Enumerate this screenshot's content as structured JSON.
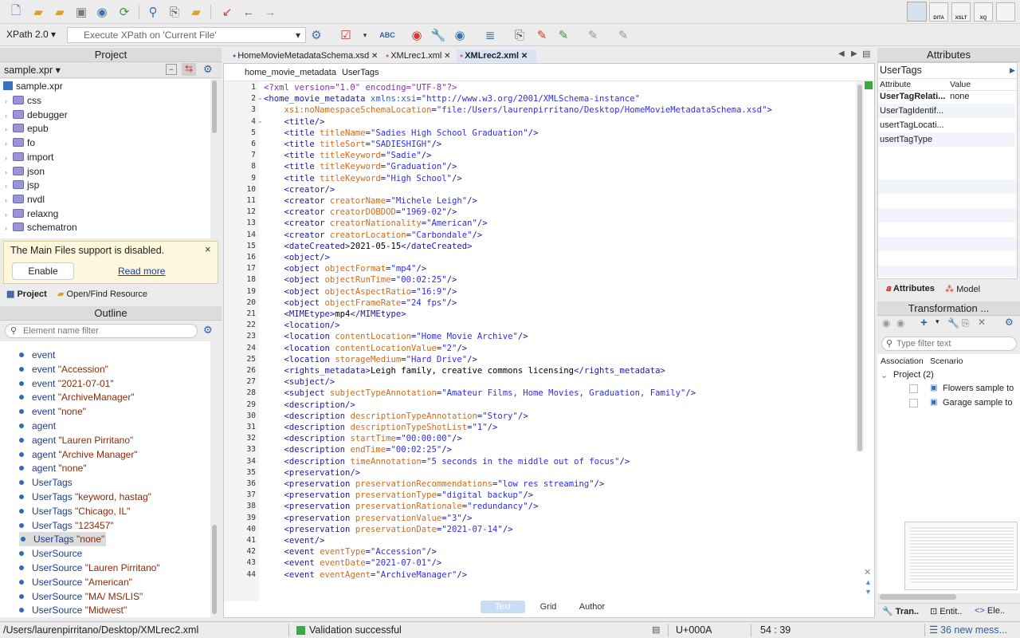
{
  "toolbar": {
    "xpath_version": "XPath 2.0",
    "xpath_placeholder": "Execute XPath on  'Current File'"
  },
  "right_toolbar": [
    "DITA",
    "XSLT",
    "XQ"
  ],
  "project": {
    "title": "Project",
    "file": "sample.xpr",
    "root": "sample.xpr",
    "folders": [
      "css",
      "debugger",
      "epub",
      "fo",
      "import",
      "json",
      "jsp",
      "nvdl",
      "relaxng",
      "schematron"
    ],
    "notice": "The Main Files support is disabled.",
    "enable": "Enable",
    "read_more": "Read more",
    "tab_project": "Project",
    "tab_find": "Open/Find Resource"
  },
  "outline": {
    "title": "Outline",
    "filter_placeholder": "Element name filter",
    "rows": [
      {
        "el": "event",
        "val": ""
      },
      {
        "el": "event",
        "val": "\"Accession\""
      },
      {
        "el": "event",
        "val": "\"2021-07-01\""
      },
      {
        "el": "event",
        "val": "\"ArchiveManager\""
      },
      {
        "el": "event",
        "val": "\"none\""
      },
      {
        "el": "agent",
        "val": ""
      },
      {
        "el": "agent",
        "val": "\"Lauren Pirritano\""
      },
      {
        "el": "agent",
        "val": "\"Archive Manager\""
      },
      {
        "el": "agent",
        "val": "\"none\""
      },
      {
        "el": "UserTags",
        "val": ""
      },
      {
        "el": "UserTags",
        "val": "\"keyword, hastag\""
      },
      {
        "el": "UserTags",
        "val": "\"Chicago, IL\""
      },
      {
        "el": "UserTags",
        "val": "\"123457\""
      },
      {
        "el": "UserTags",
        "val": "\"none\""
      },
      {
        "el": "UserSource",
        "val": ""
      },
      {
        "el": "UserSource",
        "val": "\"Lauren Pirritano\""
      },
      {
        "el": "UserSource",
        "val": "\"American\""
      },
      {
        "el": "UserSource",
        "val": "\"MA/ MS/LIS\""
      },
      {
        "el": "UserSource",
        "val": "\"Midwest\""
      }
    ]
  },
  "tabs": [
    {
      "label": "HomeMovieMetadataSchema.xsd",
      "active": false
    },
    {
      "label": "XMLrec1.xml",
      "active": false
    },
    {
      "label": "XMLrec2.xml",
      "active": true
    }
  ],
  "breadcrumb": [
    "home_movie_metadata",
    "UserTags"
  ],
  "code_lines": [
    [
      [
        "pi",
        "<?xml version=\"1.0\" encoding=\"UTF-8\"?>"
      ]
    ],
    [
      [
        "t",
        "<home_movie_metadata "
      ],
      [
        "ns",
        "xmlns:xsi"
      ],
      [
        "t",
        "="
      ],
      [
        "v",
        "\"http://www.w3.org/2001/XMLSchema-instance\""
      ]
    ],
    [
      [
        "t",
        "    "
      ],
      [
        "a",
        "xsi:noNamespaceSchemaLocation"
      ],
      [
        "t",
        "="
      ],
      [
        "v",
        "\"file:/Users/laurenpirritano/Desktop/HomeMovieMetadataSchema.xsd\""
      ],
      [
        "t",
        ">"
      ]
    ],
    [
      [
        "t",
        "    <title/>"
      ]
    ],
    [
      [
        "t",
        "    <title "
      ],
      [
        "a",
        "titleName"
      ],
      [
        "t",
        "="
      ],
      [
        "v",
        "\"Sadies High School Graduation\""
      ],
      [
        "t",
        "/>"
      ]
    ],
    [
      [
        "t",
        "    <title "
      ],
      [
        "a",
        "titleSort"
      ],
      [
        "t",
        "="
      ],
      [
        "v",
        "\"SADIESHIGH\""
      ],
      [
        "t",
        "/>"
      ]
    ],
    [
      [
        "t",
        "    <title "
      ],
      [
        "a",
        "titleKeyword"
      ],
      [
        "t",
        "="
      ],
      [
        "v",
        "\"Sadie\""
      ],
      [
        "t",
        "/>"
      ]
    ],
    [
      [
        "t",
        "    <title "
      ],
      [
        "a",
        "titleKeyword"
      ],
      [
        "t",
        "="
      ],
      [
        "v",
        "\"Graduation\""
      ],
      [
        "t",
        "/>"
      ]
    ],
    [
      [
        "t",
        "    <title "
      ],
      [
        "a",
        "titleKeyword"
      ],
      [
        "t",
        "="
      ],
      [
        "v",
        "\"High School\""
      ],
      [
        "t",
        "/>"
      ]
    ],
    [
      [
        "t",
        "    <creator/>"
      ]
    ],
    [
      [
        "t",
        "    <creator "
      ],
      [
        "a",
        "creatorName"
      ],
      [
        "t",
        "="
      ],
      [
        "v",
        "\"Michele Leigh\""
      ],
      [
        "t",
        "/>"
      ]
    ],
    [
      [
        "t",
        "    <creator "
      ],
      [
        "a",
        "creatorDOBDOD"
      ],
      [
        "t",
        "="
      ],
      [
        "v",
        "\"1969-02\""
      ],
      [
        "t",
        "/>"
      ]
    ],
    [
      [
        "t",
        "    <creator "
      ],
      [
        "a",
        "creatorNationality"
      ],
      [
        "t",
        "="
      ],
      [
        "v",
        "\"American\""
      ],
      [
        "t",
        "/>"
      ]
    ],
    [
      [
        "t",
        "    <creator "
      ],
      [
        "a",
        "creatorLocation"
      ],
      [
        "t",
        "="
      ],
      [
        "v",
        "\"Carbondale\""
      ],
      [
        "t",
        "/>"
      ]
    ],
    [
      [
        "t",
        "    <dateCreated>"
      ],
      [
        "txt",
        "2021-05-15"
      ],
      [
        "t",
        "</dateCreated>"
      ]
    ],
    [
      [
        "t",
        "    <object/>"
      ]
    ],
    [
      [
        "t",
        "    <object "
      ],
      [
        "a",
        "objectFormat"
      ],
      [
        "t",
        "="
      ],
      [
        "v",
        "\"mp4\""
      ],
      [
        "t",
        "/>"
      ]
    ],
    [
      [
        "t",
        "    <object "
      ],
      [
        "a",
        "objectRunTime"
      ],
      [
        "t",
        "="
      ],
      [
        "v",
        "\"00:02:25\""
      ],
      [
        "t",
        "/>"
      ]
    ],
    [
      [
        "t",
        "    <object "
      ],
      [
        "a",
        "objectAspectRatio"
      ],
      [
        "t",
        "="
      ],
      [
        "v",
        "\"16:9\""
      ],
      [
        "t",
        "/>"
      ]
    ],
    [
      [
        "t",
        "    <object "
      ],
      [
        "a",
        "objectFrameRate"
      ],
      [
        "t",
        "="
      ],
      [
        "v",
        "\"24 fps\""
      ],
      [
        "t",
        "/>"
      ]
    ],
    [
      [
        "t",
        "    <MIMEtype>"
      ],
      [
        "txt",
        "mp4"
      ],
      [
        "t",
        "</MIMEtype>"
      ]
    ],
    [
      [
        "t",
        "    <location/>"
      ]
    ],
    [
      [
        "t",
        "    <location "
      ],
      [
        "a",
        "contentLocation"
      ],
      [
        "t",
        "="
      ],
      [
        "v",
        "\"Home Movie Archive\""
      ],
      [
        "t",
        "/>"
      ]
    ],
    [
      [
        "t",
        "    <location "
      ],
      [
        "a",
        "contentLocationValue"
      ],
      [
        "t",
        "="
      ],
      [
        "v",
        "\"2\""
      ],
      [
        "t",
        "/>"
      ]
    ],
    [
      [
        "t",
        "    <location "
      ],
      [
        "a",
        "storageMedium"
      ],
      [
        "t",
        "="
      ],
      [
        "v",
        "\"Hard Drive\""
      ],
      [
        "t",
        "/>"
      ]
    ],
    [
      [
        "t",
        "    <rights_metadata>"
      ],
      [
        "txt",
        "Leigh family, creative commons licensing"
      ],
      [
        "t",
        "</rights_metadata>"
      ]
    ],
    [
      [
        "t",
        "    <subject/>"
      ]
    ],
    [
      [
        "t",
        "    <subject "
      ],
      [
        "a",
        "subjectTypeAnnotation"
      ],
      [
        "t",
        "="
      ],
      [
        "v",
        "\"Amateur Films, Home Movies, Graduation, Family\""
      ],
      [
        "t",
        "/>"
      ]
    ],
    [
      [
        "t",
        "    <description/>"
      ]
    ],
    [
      [
        "t",
        "    <description "
      ],
      [
        "a",
        "descriptionTypeAnnotation"
      ],
      [
        "t",
        "="
      ],
      [
        "v",
        "\"Story\""
      ],
      [
        "t",
        "/>"
      ]
    ],
    [
      [
        "t",
        "    <description "
      ],
      [
        "a",
        "descriptionTypeShotList"
      ],
      [
        "t",
        "="
      ],
      [
        "v",
        "\"1\""
      ],
      [
        "t",
        "/>"
      ]
    ],
    [
      [
        "t",
        "    <description "
      ],
      [
        "a",
        "startTime"
      ],
      [
        "t",
        "="
      ],
      [
        "v",
        "\"00:00:00\""
      ],
      [
        "t",
        "/>"
      ]
    ],
    [
      [
        "t",
        "    <description "
      ],
      [
        "a",
        "endTime"
      ],
      [
        "t",
        "="
      ],
      [
        "v",
        "\"00:02:25\""
      ],
      [
        "t",
        "/>"
      ]
    ],
    [
      [
        "t",
        "    <description "
      ],
      [
        "a",
        "timeAnnotation"
      ],
      [
        "t",
        "="
      ],
      [
        "v",
        "\"5 seconds in the middle out of focus\""
      ],
      [
        "t",
        "/>"
      ]
    ],
    [
      [
        "t",
        "    <preservation/>"
      ]
    ],
    [
      [
        "t",
        "    <preservation "
      ],
      [
        "a",
        "preservationRecommendations"
      ],
      [
        "t",
        "="
      ],
      [
        "v",
        "\"low res streaming\""
      ],
      [
        "t",
        "/>"
      ]
    ],
    [
      [
        "t",
        "    <preservation "
      ],
      [
        "a",
        "preservationType"
      ],
      [
        "t",
        "="
      ],
      [
        "v",
        "\"digital backup\""
      ],
      [
        "t",
        "/>"
      ]
    ],
    [
      [
        "t",
        "    <preservation "
      ],
      [
        "a",
        "preservationRationale"
      ],
      [
        "t",
        "="
      ],
      [
        "v",
        "\"redundancy\""
      ],
      [
        "t",
        "/>"
      ]
    ],
    [
      [
        "t",
        "    <preservation "
      ],
      [
        "a",
        "preservationValue"
      ],
      [
        "t",
        "="
      ],
      [
        "v",
        "\"3\""
      ],
      [
        "t",
        "/>"
      ]
    ],
    [
      [
        "t",
        "    <preservation "
      ],
      [
        "a",
        "preservationDate"
      ],
      [
        "t",
        "="
      ],
      [
        "v",
        "\"2021-07-14\""
      ],
      [
        "t",
        "/>"
      ]
    ],
    [
      [
        "t",
        "    <event/>"
      ]
    ],
    [
      [
        "t",
        "    <event "
      ],
      [
        "a",
        "eventType"
      ],
      [
        "t",
        "="
      ],
      [
        "v",
        "\"Accession\""
      ],
      [
        "t",
        "/>"
      ]
    ],
    [
      [
        "t",
        "    <event "
      ],
      [
        "a",
        "eventDate"
      ],
      [
        "t",
        "="
      ],
      [
        "v",
        "\"2021-07-01\""
      ],
      [
        "t",
        "/>"
      ]
    ],
    [
      [
        "t",
        "    <event "
      ],
      [
        "a",
        "eventAgent"
      ],
      [
        "t",
        "="
      ],
      [
        "v",
        "\"ArchiveManager\""
      ],
      [
        "t",
        "/>"
      ]
    ]
  ],
  "modes": [
    "Text",
    "Grid",
    "Author"
  ],
  "attributes": {
    "title": "Attributes",
    "element": "UserTags",
    "col_attr": "Attribute",
    "col_value": "Value",
    "rows": [
      {
        "name": "UserTagRelati...",
        "value": "none"
      },
      {
        "name": "UserTagIdentif...",
        "value": ""
      },
      {
        "name": "usertTagLocati...",
        "value": ""
      },
      {
        "name": "usertTagType",
        "value": ""
      }
    ],
    "tab_attributes": "Attributes",
    "tab_model": "Model"
  },
  "transformation": {
    "title": "Transformation ...",
    "filter_placeholder": "Type filter text",
    "col_assoc": "Association",
    "col_scenario": "Scenario",
    "group": "Project (2)",
    "items": [
      "Flowers sample to",
      "Garage sample to"
    ],
    "tabs": [
      "Tran..",
      "Entit..",
      "Ele.."
    ]
  },
  "status": {
    "path": "/Users/laurenpirritano/Desktop/XMLrec2.xml",
    "validation": "Validation successful",
    "unicode": "U+000A",
    "position": "54 : 39",
    "messages": "36 new mess..."
  }
}
